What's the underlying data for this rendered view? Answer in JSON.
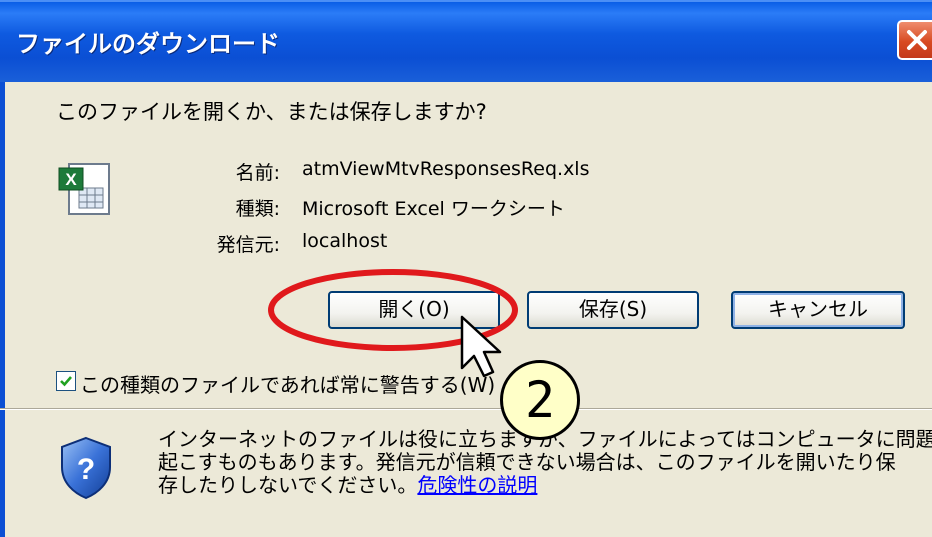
{
  "dialog": {
    "title": "ファイルのダウンロード",
    "question": "このファイルを開くか、または保存しますか?",
    "file_icon": "excel-file-icon",
    "info": [
      {
        "label": "名前:",
        "value": "atmViewMtvResponsesReq.xls"
      },
      {
        "label": "種類:",
        "value": "Microsoft Excel ワークシート"
      },
      {
        "label": "発信元:",
        "value": "localhost"
      }
    ],
    "buttons": {
      "open": "開く(O)",
      "save": "保存(S)",
      "cancel": "キャンセル"
    },
    "checkbox": {
      "label": "この種類のファイルであれば常に警告する(W)",
      "checked": true
    },
    "warning": {
      "line1": "インターネットのファイルは役に立ちますが、ファイルによってはコンピュータに問題を",
      "line2": "起こすものもあります。発信元が信頼できない場合は、このファイルを開いたり保",
      "line3_prefix": "存したりしないでください。",
      "link": "危険性の説明"
    }
  },
  "annotation": {
    "step_number": "2",
    "highlight_color": "#e0191c",
    "badge_color": "#ffffc8"
  }
}
